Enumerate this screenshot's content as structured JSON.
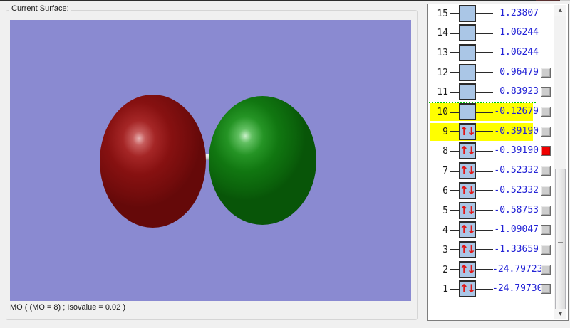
{
  "colors": {
    "window_bg": "#f0f0f0",
    "viewport_bg": "#8a8ad1",
    "energy_text": "#2323d6",
    "orbital_box_fill": "#aac6e6",
    "arrow_red": "#e01818",
    "selection_yellow": "#ffff00",
    "separator_green": "#00c800",
    "lobe_red": "#871111",
    "lobe_green": "#117711",
    "checkbox_gray": "#cdcdcd",
    "checkbox_red": "#f00000"
  },
  "icons": {
    "electron_pair": "↑↓",
    "scroll_up": "▲",
    "scroll_down": "▼"
  },
  "surface_panel": {
    "label": "Current Surface:",
    "caption": "MO ( (MO = 8) ; Isovalue = 0.02 )",
    "lobes": [
      {
        "name": "negative-phase-lobe",
        "color": "#871111"
      },
      {
        "name": "positive-phase-lobe",
        "color": "#117711"
      }
    ]
  },
  "orbital_panel": {
    "separator_after_row": 11,
    "rows": [
      {
        "n": "15",
        "energy": "1.23807",
        "occupied": false,
        "checkbox": null,
        "highlighted": false
      },
      {
        "n": "14",
        "energy": "1.06244",
        "occupied": false,
        "checkbox": null,
        "highlighted": false
      },
      {
        "n": "13",
        "energy": "1.06244",
        "occupied": false,
        "checkbox": null,
        "highlighted": false
      },
      {
        "n": "12",
        "energy": "0.96479",
        "occupied": false,
        "checkbox": "gray",
        "highlighted": false
      },
      {
        "n": "11",
        "energy": "0.83923",
        "occupied": false,
        "checkbox": "gray",
        "highlighted": false
      },
      {
        "n": "10",
        "energy": "-0.12679",
        "occupied": false,
        "checkbox": "gray",
        "highlighted": true
      },
      {
        "n": "9",
        "energy": "-0.39190",
        "occupied": true,
        "checkbox": "gray",
        "highlighted": true
      },
      {
        "n": "8",
        "energy": "-0.39190",
        "occupied": true,
        "checkbox": "red",
        "highlighted": false
      },
      {
        "n": "7",
        "energy": "-0.52332",
        "occupied": true,
        "checkbox": "gray",
        "highlighted": false
      },
      {
        "n": "6",
        "energy": "-0.52332",
        "occupied": true,
        "checkbox": "gray",
        "highlighted": false
      },
      {
        "n": "5",
        "energy": "-0.58753",
        "occupied": true,
        "checkbox": "gray",
        "highlighted": false
      },
      {
        "n": "4",
        "energy": "-1.09047",
        "occupied": true,
        "checkbox": "gray",
        "highlighted": false
      },
      {
        "n": "3",
        "energy": "-1.33659",
        "occupied": true,
        "checkbox": "gray",
        "highlighted": false
      },
      {
        "n": "2",
        "energy": "-24.79723",
        "occupied": true,
        "checkbox": "gray",
        "highlighted": false
      },
      {
        "n": "1",
        "energy": "-24.79730",
        "occupied": true,
        "checkbox": "gray",
        "highlighted": false
      }
    ]
  }
}
